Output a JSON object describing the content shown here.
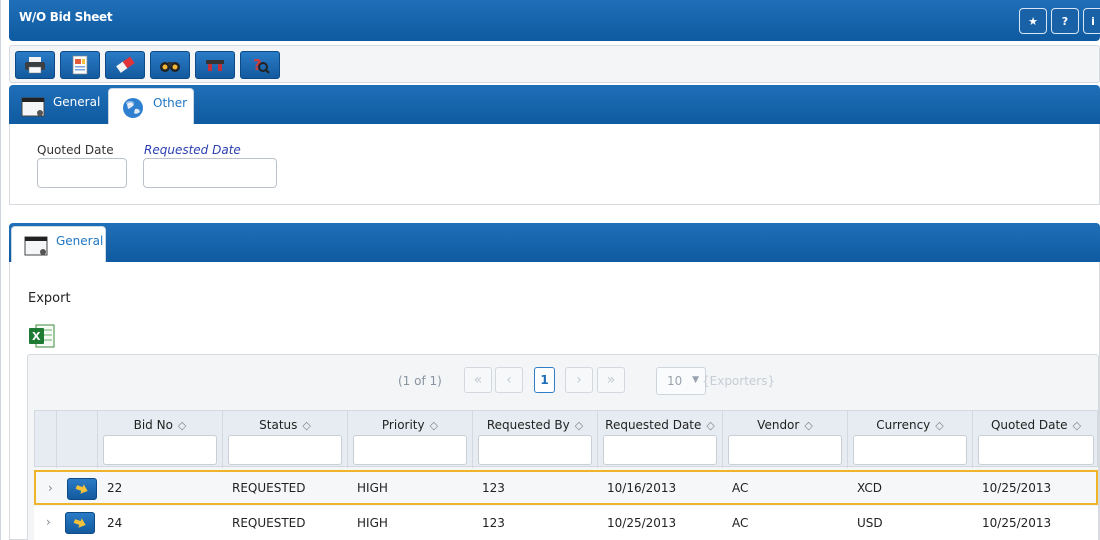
{
  "window": {
    "title": "W/O Bid Sheet",
    "buttons": [
      {
        "name": "favorite",
        "glyph": "★"
      },
      {
        "name": "help",
        "glyph": "?"
      },
      {
        "name": "info",
        "glyph": "i"
      }
    ]
  },
  "toolbar": {
    "buttons": [
      {
        "name": "print-icon"
      },
      {
        "name": "report-icon"
      },
      {
        "name": "eraser-icon"
      },
      {
        "name": "binoculars-icon"
      },
      {
        "name": "search-filter-icon"
      },
      {
        "name": "help-search-icon"
      }
    ]
  },
  "top_tabs": [
    {
      "label": "General",
      "active": false
    },
    {
      "label": "Other",
      "active": true
    }
  ],
  "other_fields": {
    "quoted_date_label": "Quoted Date",
    "quoted_date_value": "",
    "requested_date_label": "Requested Date",
    "requested_date_value": ""
  },
  "lower_tabs": [
    {
      "label": "General",
      "active": true
    }
  ],
  "export": {
    "label": "Export",
    "excel_icon": "excel-icon"
  },
  "paginator": {
    "summary": "(1 of 1)",
    "current_page": "1",
    "rows_per_page": "10",
    "exporters": "{Exporters}"
  },
  "table": {
    "columns": [
      "Bid No",
      "Status",
      "Priority",
      "Requested By",
      "Requested Date",
      "Vendor",
      "Currency",
      "Quoted Date"
    ],
    "rows": [
      {
        "bid_no": "22",
        "status": "REQUESTED",
        "priority": "HIGH",
        "requested_by": "123",
        "requested_date": "10/16/2013",
        "vendor": "AC",
        "currency": "XCD",
        "quoted_date": "10/25/2013",
        "selected": true
      },
      {
        "bid_no": "24",
        "status": "REQUESTED",
        "priority": "HIGH",
        "requested_by": "123",
        "requested_date": "10/25/2013",
        "vendor": "AC",
        "currency": "USD",
        "quoted_date": "10/25/2013",
        "selected": false
      }
    ]
  },
  "colors": {
    "header_blue": "#1565b0",
    "selection_outline": "#f0b429"
  }
}
